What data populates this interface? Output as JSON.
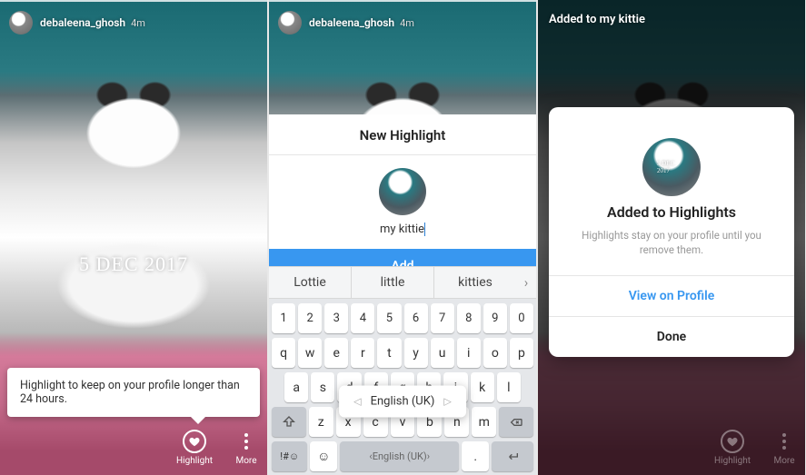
{
  "panel1": {
    "username": "debaleena_ghosh",
    "time": "4m",
    "date_stamp": "5 DEC 2017",
    "tooltip": "Highlight to keep on your profile longer than 24 hours.",
    "highlight_label": "Highlight",
    "more_label": "More"
  },
  "panel2": {
    "username": "debaleena_ghosh",
    "time": "4m",
    "sheet_title": "New Highlight",
    "input_value": "my kittie",
    "add_label": "Add",
    "suggestions": [
      "Lottie",
      "little",
      "kitties"
    ],
    "lang_label": "English (UK)",
    "space_label": "English (UK)",
    "sym_label": "!#☺",
    "rows": {
      "nums": [
        "1",
        "2",
        "3",
        "4",
        "5",
        "6",
        "7",
        "8",
        "9",
        "0"
      ],
      "r1": [
        "q",
        "w",
        "e",
        "r",
        "t",
        "y",
        "u",
        "i",
        "o",
        "p"
      ],
      "r2": [
        "a",
        "s",
        "d",
        "f",
        "g",
        "h",
        "j",
        "k",
        "l"
      ],
      "r3": [
        "z",
        "x",
        "c",
        "v",
        "b",
        "n",
        "m"
      ]
    }
  },
  "panel3": {
    "header": "Added to my kittie",
    "title": "Added to Highlights",
    "subtitle": "Highlights stay on your profile until you remove them.",
    "view_label": "View on Profile",
    "done_label": "Done",
    "bottom_highlight": "Highlight",
    "bottom_more": "More"
  }
}
